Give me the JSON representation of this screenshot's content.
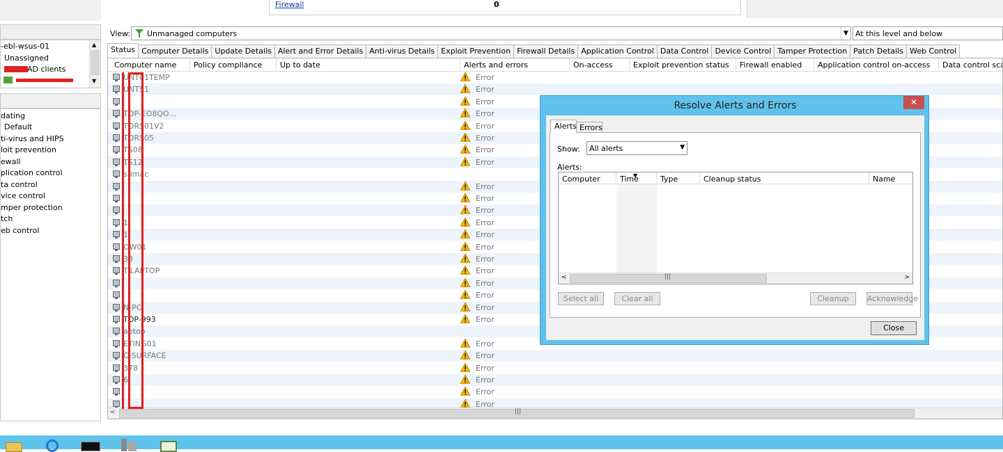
{
  "top_panel": {
    "link": "Firewall",
    "value": "0"
  },
  "tree": {
    "items": [
      {
        "label": "-ebl-wsus-01"
      },
      {
        "label": "Unassigned"
      },
      {
        "label": "AD clients"
      },
      {
        "label": ""
      }
    ]
  },
  "policies": {
    "items": [
      {
        "label": "dating"
      },
      {
        "label": "Default"
      },
      {
        "label": "ti-virus and HIPS"
      },
      {
        "label": "loit prevention"
      },
      {
        "label": "ewall"
      },
      {
        "label": "plication control"
      },
      {
        "label": "ta control"
      },
      {
        "label": "vice control"
      },
      {
        "label": "mper protection"
      },
      {
        "label": "tch"
      },
      {
        "label": "eb control"
      }
    ]
  },
  "view": {
    "label": "View:",
    "value": "Unmanaged computers",
    "level": "At this level and below"
  },
  "tabs": [
    {
      "label": "Status"
    },
    {
      "label": "Computer Details"
    },
    {
      "label": "Update Details"
    },
    {
      "label": "Alert and Error Details"
    },
    {
      "label": "Anti-virus Details"
    },
    {
      "label": "Exploit Prevention"
    },
    {
      "label": "Firewall Details"
    },
    {
      "label": "Application Control"
    },
    {
      "label": "Data Control"
    },
    {
      "label": "Device Control"
    },
    {
      "label": "Tamper Protection"
    },
    {
      "label": "Patch Details"
    },
    {
      "label": "Web Control"
    }
  ],
  "grid": {
    "columns": [
      {
        "label": "Computer name"
      },
      {
        "label": "Policy compliance"
      },
      {
        "label": "Up to date"
      },
      {
        "label": "Alerts and errors"
      },
      {
        "label": "On-access"
      },
      {
        "label": "Exploit prevention status"
      },
      {
        "label": "Firewall enabled"
      },
      {
        "label": "Application control on-access"
      },
      {
        "label": "Data control scann"
      }
    ],
    "rows": [
      {
        "name": "UNT01TEMP",
        "status": "Error"
      },
      {
        "name": "UNTS1",
        "status": "Error"
      },
      {
        "name": "",
        "status": "Error"
      },
      {
        "name": "TOP-EO8QO...",
        "status": "Error"
      },
      {
        "name": "TORS01V2",
        "status": "Error"
      },
      {
        "name": "TORS05",
        "status": "Error"
      },
      {
        "name": "TS08",
        "status": "Error"
      },
      {
        "name": "TS12",
        "status": "Error"
      },
      {
        "name": "s-imac",
        "status": ""
      },
      {
        "name": "",
        "status": "Error"
      },
      {
        "name": "",
        "status": "Error"
      },
      {
        "name": "",
        "status": "Error"
      },
      {
        "name": "1",
        "status": "Error"
      },
      {
        "name": "1",
        "status": "Error"
      },
      {
        "name": "OW01",
        "status": "Error"
      },
      {
        "name": "38",
        "status": "Error"
      },
      {
        "name": "T-LAPTOP",
        "status": "Error"
      },
      {
        "name": "",
        "status": "Error"
      },
      {
        "name": "",
        "status": "Error"
      },
      {
        "name": "N-PC",
        "status": "Error"
      },
      {
        "name": "TOP-993",
        "status": "Error"
      },
      {
        "name": "aptop",
        "status": ""
      },
      {
        "name": "ETING01",
        "status": "Error"
      },
      {
        "name": "C-SURFACE",
        "status": "Error"
      },
      {
        "name": "378",
        "status": "Error"
      },
      {
        "name": "6",
        "status": "Error"
      },
      {
        "name": "",
        "status": "Error"
      },
      {
        "name": "",
        "status": "Error"
      }
    ]
  },
  "dialog": {
    "title": "Resolve Alerts and Errors",
    "close_x": "✕",
    "tabs": [
      {
        "label": "Alerts"
      },
      {
        "label": "Errors"
      }
    ],
    "show_label": "Show:",
    "show_value": "All alerts",
    "alerts_label": "Alerts:",
    "columns": [
      {
        "label": "Computer"
      },
      {
        "label": "Time"
      },
      {
        "label": "Type"
      },
      {
        "label": "Cleanup status"
      },
      {
        "label": "Name"
      }
    ],
    "buttons": {
      "select_all": "Select all",
      "clear_all": "Clear all",
      "cleanup": "Cleanup",
      "acknowledge": "Acknowledge",
      "close": "Close"
    }
  },
  "colors": {
    "taskbar": "#5ec4ec",
    "dialog_frame": "#60c2ec",
    "close_red": "#c75050",
    "warning": "#f4b400"
  }
}
